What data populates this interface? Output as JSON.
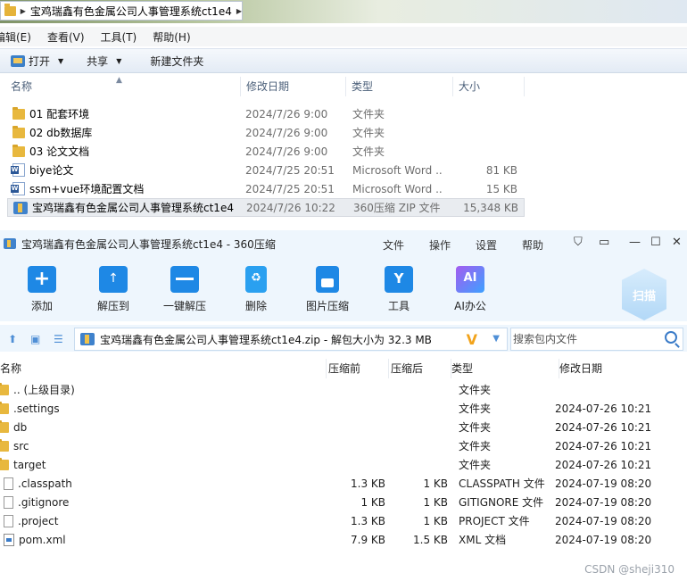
{
  "explorer": {
    "breadcrumb_title": "宝鸡瑞鑫有色金属公司人事管理系统ct1e4",
    "menu": [
      "编辑(E)",
      "查看(V)",
      "工具(T)",
      "帮助(H)"
    ],
    "toolbar": {
      "open_label": "打开",
      "share_label": "共享",
      "new_folder_label": "新建文件夹"
    },
    "columns": {
      "name": "名称",
      "date": "修改日期",
      "type": "类型",
      "size": "大小"
    },
    "files": [
      {
        "icon": "folder-icon",
        "name": "01 配套环境",
        "date": "2024/7/26 9:00",
        "type": "文件夹",
        "size": ""
      },
      {
        "icon": "folder-icon",
        "name": "02 db数据库",
        "date": "2024/7/26 9:00",
        "type": "文件夹",
        "size": ""
      },
      {
        "icon": "folder-icon",
        "name": "03 论文文档",
        "date": "2024/7/26 9:00",
        "type": "文件夹",
        "size": ""
      },
      {
        "icon": "word-doc-icon",
        "name": "biye论文",
        "date": "2024/7/25 20:51",
        "type": "Microsoft Word ...",
        "size": "81 KB"
      },
      {
        "icon": "word-doc-icon",
        "name": "ssm+vue环境配置文档",
        "date": "2024/7/25 20:51",
        "type": "Microsoft Word ...",
        "size": "15 KB"
      },
      {
        "icon": "zip-archive-icon",
        "name": "宝鸡瑞鑫有色金属公司人事管理系统ct1e4",
        "date": "2024/7/26 10:22",
        "type": "360压缩 ZIP 文件",
        "size": "15,348 KB",
        "selected": true
      }
    ]
  },
  "zip_window": {
    "title": "宝鸡瑞鑫有色金属公司人事管理系统ct1e4 - 360压缩",
    "menus": [
      "文件",
      "操作",
      "设置",
      "帮助"
    ],
    "tools": [
      {
        "label": "添加",
        "icon": "add-icon"
      },
      {
        "label": "解压到",
        "icon": "extract-to-icon"
      },
      {
        "label": "一键解压",
        "icon": "one-click-extract-icon"
      },
      {
        "label": "删除",
        "icon": "delete-icon"
      },
      {
        "label": "图片压缩",
        "icon": "image-compress-icon"
      },
      {
        "label": "工具",
        "icon": "tools-icon"
      },
      {
        "label": "AI办公",
        "icon": "ai-office-icon"
      }
    ],
    "scan_label": "扫描",
    "path_text": "宝鸡瑞鑫有色金属公司人事管理系统ct1e4.zip - 解包大小为 32.3 MB",
    "search_placeholder": "搜索包内文件",
    "columns": {
      "name": "名称",
      "original": "压缩前",
      "compressed": "压缩后",
      "type": "类型",
      "date": "修改日期"
    },
    "entries": [
      {
        "icon": "folder-icon",
        "name": ".. (上级目录)",
        "original": "",
        "compressed": "",
        "type": "文件夹",
        "date": ""
      },
      {
        "icon": "folder-icon",
        "name": ".settings",
        "original": "",
        "compressed": "",
        "type": "文件夹",
        "date": "2024-07-26 10:21"
      },
      {
        "icon": "folder-icon",
        "name": "db",
        "original": "",
        "compressed": "",
        "type": "文件夹",
        "date": "2024-07-26 10:21"
      },
      {
        "icon": "folder-icon",
        "name": "src",
        "original": "",
        "compressed": "",
        "type": "文件夹",
        "date": "2024-07-26 10:21"
      },
      {
        "icon": "folder-icon",
        "name": "target",
        "original": "",
        "compressed": "",
        "type": "文件夹",
        "date": "2024-07-26 10:21"
      },
      {
        "icon": "file-icon",
        "name": ".classpath",
        "original": "1.3 KB",
        "compressed": "1 KB",
        "type": "CLASSPATH 文件",
        "date": "2024-07-19 08:20"
      },
      {
        "icon": "file-icon",
        "name": ".gitignore",
        "original": "1 KB",
        "compressed": "1 KB",
        "type": "GITIGNORE 文件",
        "date": "2024-07-19 08:20"
      },
      {
        "icon": "file-icon",
        "name": ".project",
        "original": "1.3 KB",
        "compressed": "1 KB",
        "type": "PROJECT 文件",
        "date": "2024-07-19 08:20"
      },
      {
        "icon": "xml-file-icon",
        "name": "pom.xml",
        "original": "7.9 KB",
        "compressed": "1.5 KB",
        "type": "XML 文档",
        "date": "2024-07-19 08:20"
      }
    ]
  },
  "watermark": "CSDN @sheji310"
}
